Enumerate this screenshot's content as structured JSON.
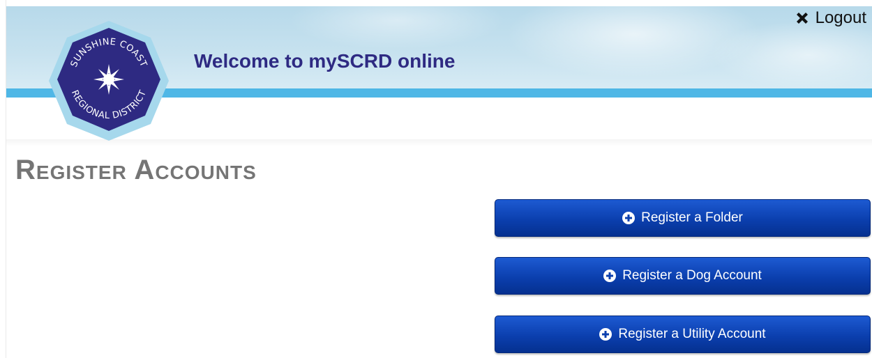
{
  "header": {
    "welcome_text": "Welcome to mySCRD online",
    "logout_label": "Logout",
    "logo": {
      "top_text": "SUNSHINE COAST",
      "bottom_text": "REGIONAL DISTRICT"
    }
  },
  "page": {
    "title": "Register Accounts"
  },
  "actions": [
    {
      "icon": "plus-circle-icon",
      "label": "Register a Folder"
    },
    {
      "icon": "plus-circle-icon",
      "label": "Register a Dog Account"
    },
    {
      "icon": "plus-circle-icon",
      "label": "Register a Utility Account"
    }
  ],
  "colors": {
    "brand_navy": "#2e2a82",
    "header_stripe": "#4fb7e6",
    "button_blue": "#0b3fae",
    "title_gray": "#757575"
  }
}
